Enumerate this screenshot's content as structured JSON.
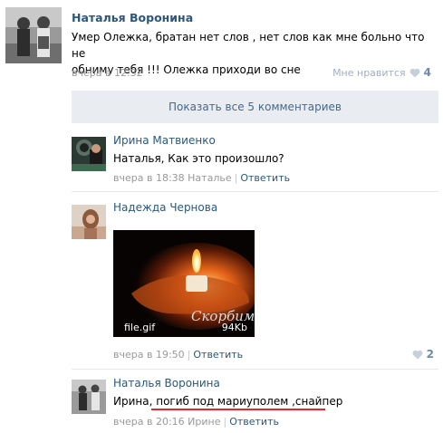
{
  "post": {
    "author": "Наталья Воронина",
    "text_line1": "Умер Олежка, братан нет слов , нет слов как мне больно что не",
    "text_line2": "обниму тебя !!! Олежка приходи во сне",
    "time": "вчера в 12:32",
    "like_label": "Мне нравится",
    "like_count": "4"
  },
  "show_all": "Показать все 5 комментариев",
  "comments": [
    {
      "author": "Ирина Матвиенко",
      "text": "Наталья, Как это произошло?",
      "time": "вчера в 18:38",
      "reply_to": "Наталье",
      "reply_label": "Ответить"
    },
    {
      "author": "Надежда Чернова",
      "attachment_name": "file.gif",
      "attachment_size": "94Kb",
      "attachment_caption": "Скорбим",
      "time": "вчера в 19:50",
      "reply_label": "Ответить",
      "like_count": "2"
    },
    {
      "author": "Наталья Воронина",
      "text_prefix": "Ирина,",
      "text_highlight": "погиб под мариуполем ,снайпер",
      "time": "вчера в 20:16",
      "reply_to": "Ирине",
      "reply_label": "Ответить"
    }
  ],
  "colors": {
    "link": "#2b587a",
    "meta": "#999999",
    "show_all_bg": "#e9edf1",
    "underline": "#e8252a"
  }
}
